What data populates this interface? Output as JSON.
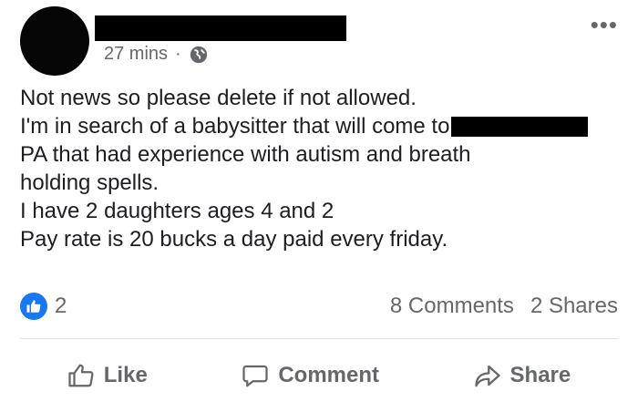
{
  "post": {
    "timestamp": "27 mins",
    "separator": "·",
    "privacy_icon": "globe-icon",
    "more_icon": "more-dots-icon",
    "lines": {
      "l1": "Not news so please delete if not allowed.",
      "l2": "I'm in search of a babysitter that will come to",
      "l3": "PA that had experience with autism and breath",
      "l4": "holding spells.",
      "l5": "I have 2 daughters ages 4 and 2",
      "l6": "Pay rate is 20 bucks a day paid every friday."
    }
  },
  "stats": {
    "reaction_count": "2",
    "comments": "8 Comments",
    "shares": "2 Shares"
  },
  "actions": {
    "like": "Like",
    "comment": "Comment",
    "share": "Share"
  },
  "colors": {
    "accent": "#1877f2",
    "secondary_text": "#65676b",
    "primary_text": "#1c1e21"
  }
}
